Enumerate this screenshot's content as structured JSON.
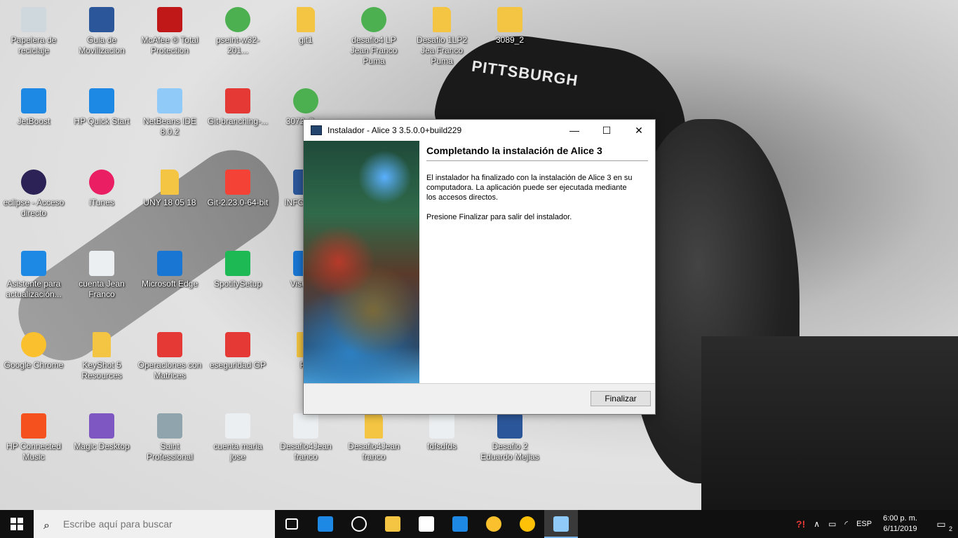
{
  "wallpaper": {
    "cap_text": "PITTSBURGH"
  },
  "desktop_icons": [
    {
      "label": "Papelera de reciclaje",
      "icon": "recycle-bin-icon",
      "color": "#cfd8dc"
    },
    {
      "label": "Guia de Movilizacion",
      "icon": "word-icon",
      "color": "#2b579a"
    },
    {
      "label": "McAfee ® Total Protection",
      "icon": "mcafee-icon",
      "color": "#c01818"
    },
    {
      "label": "pseint-w32-201...",
      "icon": "installer-icon",
      "color": "#4caf50"
    },
    {
      "label": "git1",
      "icon": "folder-icon",
      "color": "#f4c542"
    },
    {
      "label": "desafio4 LP Jean Franco Puma",
      "icon": "installer-icon",
      "color": "#4caf50"
    },
    {
      "label": "Desafio 1LP2 Jea Franco Puma",
      "icon": "folder-icon",
      "color": "#f4c542"
    },
    {
      "label": "3089_2",
      "icon": "rar-icon",
      "color": "#f4c542"
    },
    {
      "label": "JetBoost",
      "icon": "jetboost-icon",
      "color": "#1e88e5"
    },
    {
      "label": "HP Quick Start",
      "icon": "rocket-icon",
      "color": "#1e88e5"
    },
    {
      "label": "NetBeans IDE 8.0.2",
      "icon": "netbeans-icon",
      "color": "#90caf9"
    },
    {
      "label": "Git-branching-...",
      "icon": "pdf-icon",
      "color": "#e53935"
    },
    {
      "label": "3072_3_...",
      "icon": "installer-icon",
      "color": "#4caf50"
    },
    {
      "label": "eclipse - Acceso directo",
      "icon": "eclipse-icon",
      "color": "#2c2255"
    },
    {
      "label": "iTunes",
      "icon": "itunes-icon",
      "color": "#e91e63"
    },
    {
      "label": "UNY 18 05 18",
      "icon": "folder-icon",
      "color": "#f4c542"
    },
    {
      "label": "Git-2.23.0-64-bit",
      "icon": "git-icon",
      "color": "#f44336"
    },
    {
      "label": "INFO CHIN",
      "icon": "word-icon",
      "color": "#2b579a"
    },
    {
      "label": "Asistente para actualización...",
      "icon": "windows-icon",
      "color": "#1e88e5"
    },
    {
      "label": "cuenta Jean Franco",
      "icon": "image-file-icon",
      "color": "#eceff1"
    },
    {
      "label": "Microsoft Edge",
      "icon": "edge-icon",
      "color": "#1976d2"
    },
    {
      "label": "SpotifySetup",
      "icon": "spotify-icon",
      "color": "#1db954"
    },
    {
      "label": "Visual C",
      "icon": "vs-icon",
      "color": "#1976d2"
    },
    {
      "label": "Google Chrome",
      "icon": "chrome-icon",
      "color": "#fbc02d"
    },
    {
      "label": "KeyShot 5 Resources",
      "icon": "folder-icon",
      "color": "#f4c542"
    },
    {
      "label": "Operaciones con Matrices",
      "icon": "pdf-icon",
      "color": "#e53935"
    },
    {
      "label": "eseguridad GP",
      "icon": "pdf-icon",
      "color": "#e53935"
    },
    {
      "label": "PC",
      "icon": "folder-icon",
      "color": "#f4c542"
    },
    {
      "label": "HP Connected Music",
      "icon": "hp-music-icon",
      "color": "#f4511e"
    },
    {
      "label": "Magic Desktop",
      "icon": "magic-desktop-icon",
      "color": "#7e57c2"
    },
    {
      "label": "Saint Professional",
      "icon": "saint-icon",
      "color": "#90a4ae"
    },
    {
      "label": "cuenta maria jose",
      "icon": "image-file-icon",
      "color": "#eceff1"
    },
    {
      "label": "Desafio4Jean franco",
      "icon": "text-file-icon",
      "color": "#eceff1"
    },
    {
      "label": "Desafio4Jean franco",
      "icon": "zip-folder-icon",
      "color": "#f4c542"
    },
    {
      "label": "fdfsdfds",
      "icon": "text-file-icon",
      "color": "#eceff1"
    },
    {
      "label": "Desafio 2 Eduardo Mejias",
      "icon": "word-icon",
      "color": "#2b579a"
    }
  ],
  "dialog": {
    "title": "Instalador - Alice 3 3.5.0.0+build229",
    "minimize": "—",
    "maximize": "☐",
    "close": "✕",
    "heading": "Completando la instalación de Alice 3",
    "para1": "El instalador ha finalizado con la instalación de Alice 3 en su computadora. La aplicación puede ser ejecutada mediante los accesos directos.",
    "para2": "Presione Finalizar para salir del instalador.",
    "finish_label": "Finalizar"
  },
  "taskbar": {
    "search_placeholder": "Escribe aquí para buscar",
    "apps": [
      {
        "name": "task-view-icon",
        "color": "#ffffff"
      },
      {
        "name": "edge-icon",
        "color": "#1e88e5"
      },
      {
        "name": "hp-icon",
        "color": "#ffffff"
      },
      {
        "name": "file-explorer-icon",
        "color": "#f4c542"
      },
      {
        "name": "store-icon",
        "color": "#ffffff"
      },
      {
        "name": "hp-quick-start-icon",
        "color": "#1e88e5"
      },
      {
        "name": "chrome-icon",
        "color": "#fbc02d"
      },
      {
        "name": "game-icon",
        "color": "#ffc107"
      },
      {
        "name": "installer-icon",
        "color": "#90caf9"
      }
    ],
    "language": "ESP",
    "time": "6:00 p. m.",
    "date": "6/11/2019",
    "notifications_count": "2"
  }
}
